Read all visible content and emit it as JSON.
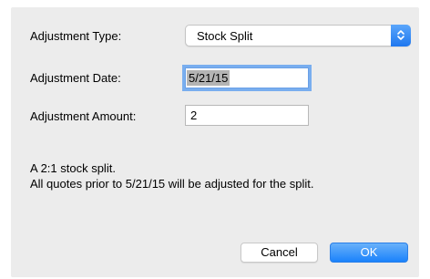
{
  "form": {
    "type_label": "Adjustment Type:",
    "type_value": "Stock Split",
    "date_label": "Adjustment Date:",
    "date_value": "5/21/15",
    "amount_label": "Adjustment Amount:",
    "amount_value": "2"
  },
  "message": {
    "line1": "A 2:1 stock split.",
    "line2": "All quotes prior to 5/21/15 will be adjusted for the split."
  },
  "buttons": {
    "cancel": "Cancel",
    "ok": "OK"
  },
  "icons": {
    "select_stepper": "up-down-chevron-icon"
  },
  "colors": {
    "accent": "#1a82fb",
    "dialog_background": "#ececec",
    "focus_ring": "#79aeef"
  }
}
